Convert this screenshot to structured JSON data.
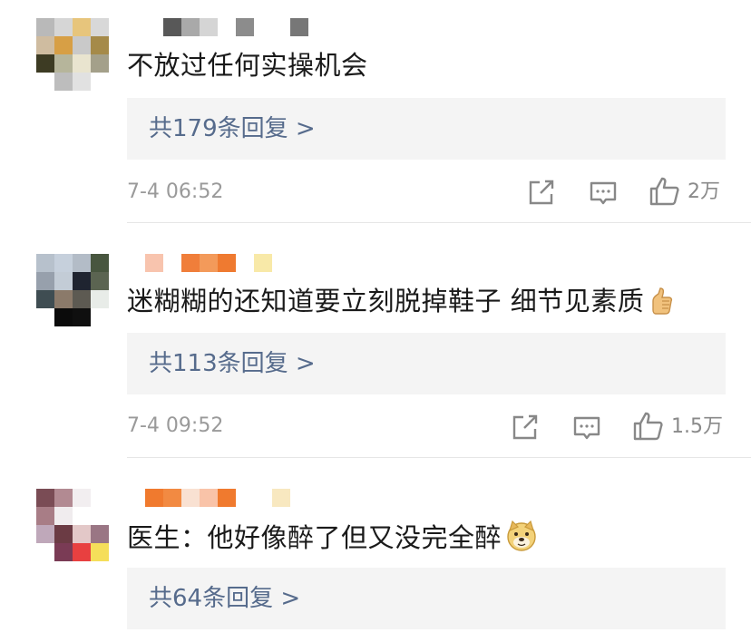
{
  "comments": [
    {
      "text": "不放过任何实操机会",
      "reply_label": "共179条回复 >",
      "time": "7-4 06:52",
      "likes": "2万",
      "emoji": ""
    },
    {
      "text": "迷糊糊的还知道要立刻脱掉鞋子 细节见素质",
      "reply_label": "共113条回复 >",
      "time": "7-4 09:52",
      "likes": "1.5万",
      "emoji": "thumbs-up"
    },
    {
      "text": "医生：他好像醉了但又没完全醉",
      "reply_label": "共64条回复 >",
      "emoji": "doge"
    }
  ],
  "icons": {
    "share": "share-icon",
    "comment": "comment-icon",
    "like": "like-icon"
  }
}
